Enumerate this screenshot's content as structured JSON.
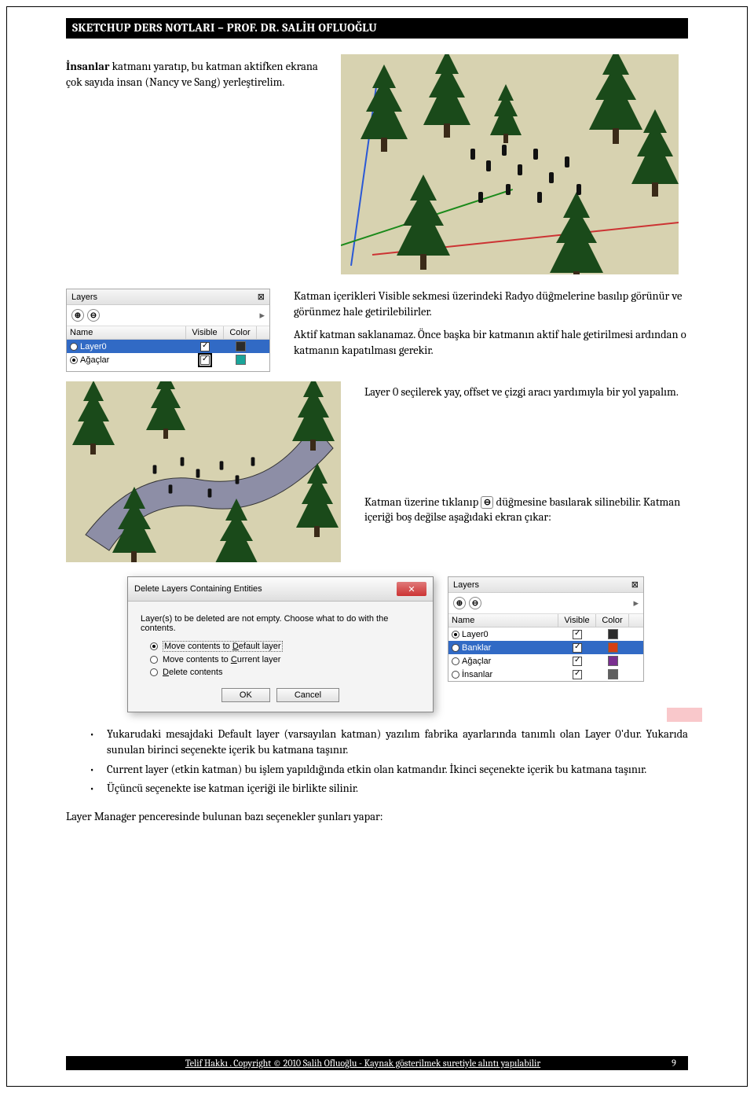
{
  "header": "SKETCHUP DERS NOTLARI – PROF. DR. SALİH OFLUOĞLU",
  "intro": {
    "bold": "İnsanlar",
    "rest": " katmanı yaratıp, bu katman aktifken ekrana çok sayıda insan (Nancy ve Sang) yerleştirelim."
  },
  "para2a": "Katman içerikleri Visible sekmesi üzerindeki Radyo düğmelerine basılıp görünür ve görünmez hale getirilebilirler.",
  "para2b": "Aktif katman saklanamaz. Önce başka bir katmanın aktif hale getirilmesi ardından o katmanın kapatılması gerekir.",
  "para3": "Layer 0 seçilerek yay, offset ve çizgi aracı yardımıyla bir yol yapalım.",
  "para4a": "Katman üzerine tıklanıp ",
  "para4b": " düğmesine basılarak silinebilir. Katman içeriği boş değilse aşağıdaki ekran çıkar:",
  "minus_icon": "⊖",
  "layers_panel1": {
    "title": "Layers",
    "cols": {
      "name": "Name",
      "visible": "Visible",
      "color": "Color"
    },
    "rows": [
      {
        "name": "Layer0",
        "active": false,
        "sel": true,
        "vis": true,
        "color": "#2b2b2b"
      },
      {
        "name": "Ağaçlar",
        "active": true,
        "sel": false,
        "vis": true,
        "color": "#1aa59a"
      }
    ]
  },
  "layers_panel2": {
    "title": "Layers",
    "cols": {
      "name": "Name",
      "visible": "Visible",
      "color": "Color"
    },
    "rows": [
      {
        "name": "Layer0",
        "active": true,
        "sel": false,
        "vis": true,
        "color": "#2b2b2b"
      },
      {
        "name": "Banklar",
        "active": false,
        "sel": true,
        "vis": true,
        "color": "#d63f13"
      },
      {
        "name": "Ağaçlar",
        "active": false,
        "sel": false,
        "vis": true,
        "color": "#7a2f8f"
      },
      {
        "name": "İnsanlar",
        "active": false,
        "sel": false,
        "vis": true,
        "color": "#5f5f5f"
      }
    ]
  },
  "dialog": {
    "title": "Delete Layers Containing Entities",
    "msg": "Layer(s) to be deleted are not empty.  Choose what to do with the contents.",
    "opt1_a": "Move contents to ",
    "opt1_b": "D",
    "opt1_c": "efault layer",
    "opt2_a": "Move contents to ",
    "opt2_b": "C",
    "opt2_c": "urrent layer",
    "opt3_a": "D",
    "opt3_b": "elete contents",
    "ok": "OK",
    "cancel": "Cancel"
  },
  "bullets": [
    "Yukarudaki mesajdaki Default layer (varsayılan katman) yazılım fabrika ayarlarında tanımlı olan Layer 0'dur. Yukarıda sunulan birinci seçenekte içerik bu katmana taşınır.",
    "Current layer (etkin katman) bu işlem yapıldığında etkin olan katmandır. İkinci seçenekte içerik bu katmana taşınır.",
    "Üçüncü seçenekte ise katman içeriği ile birlikte silinir."
  ],
  "final_para": "Layer Manager penceresinde bulunan bazı seçenekler şunları yapar:",
  "footer": {
    "text": "Telif Hakkı . Copyright © 2010 Salih Ofluoğlu - Kaynak gösterilmek suretiyle alıntı yapılabilir",
    "page": "9"
  },
  "icons": {
    "plus": "⊕",
    "minus": "⊖",
    "menu": "▸",
    "close": "✕",
    "pin": "⊠"
  }
}
